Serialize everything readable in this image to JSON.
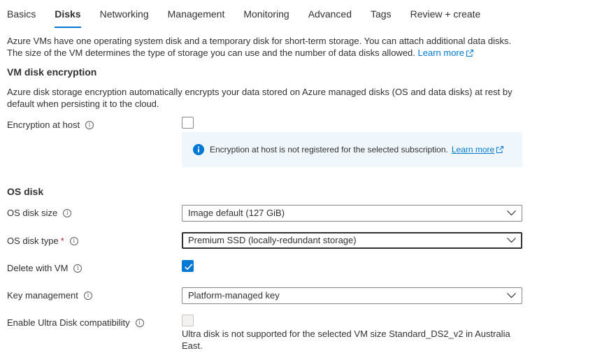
{
  "tabs": [
    {
      "label": "Basics"
    },
    {
      "label": "Disks"
    },
    {
      "label": "Networking"
    },
    {
      "label": "Management"
    },
    {
      "label": "Monitoring"
    },
    {
      "label": "Advanced"
    },
    {
      "label": "Tags"
    },
    {
      "label": "Review + create"
    }
  ],
  "active_tab": "Disks",
  "intro": {
    "line1": "Azure VMs have one operating system disk and a temporary disk for short-term storage. You can attach additional data disks.",
    "line2": "The size of the VM determines the type of storage you can use and the number of data disks allowed.",
    "learn_more": "Learn more"
  },
  "encryption": {
    "heading": "VM disk encryption",
    "description": "Azure disk storage encryption automatically encrypts your data stored on Azure managed disks (OS and data disks) at rest by default when persisting it to the cloud.",
    "host_label": "Encryption at host",
    "host_checked": false,
    "banner_text": "Encryption at host is not registered for the selected subscription.",
    "banner_link": "Learn more"
  },
  "os_disk": {
    "heading": "OS disk",
    "size_label": "OS disk size",
    "size_value": "Image default (127 GiB)",
    "type_label": "OS disk type",
    "type_required_marker": "*",
    "type_value": "Premium SSD (locally-redundant storage)",
    "delete_label": "Delete with VM",
    "delete_checked": true,
    "key_label": "Key management",
    "key_value": "Platform-managed key",
    "ultra_label": "Enable Ultra Disk compatibility",
    "ultra_checked": false,
    "ultra_note": "Ultra disk is not supported for the selected VM size Standard_DS2_v2 in Australia East."
  },
  "colors": {
    "accent": "#0078d4",
    "info_banner_bg": "#eff6fc",
    "required": "#a4262c",
    "text": "#323130"
  },
  "icons": {
    "info": "info-circle-icon",
    "external": "external-link-icon",
    "chevron": "chevron-down-icon",
    "banner": "info-filled-icon",
    "check": "checkmark-icon"
  }
}
